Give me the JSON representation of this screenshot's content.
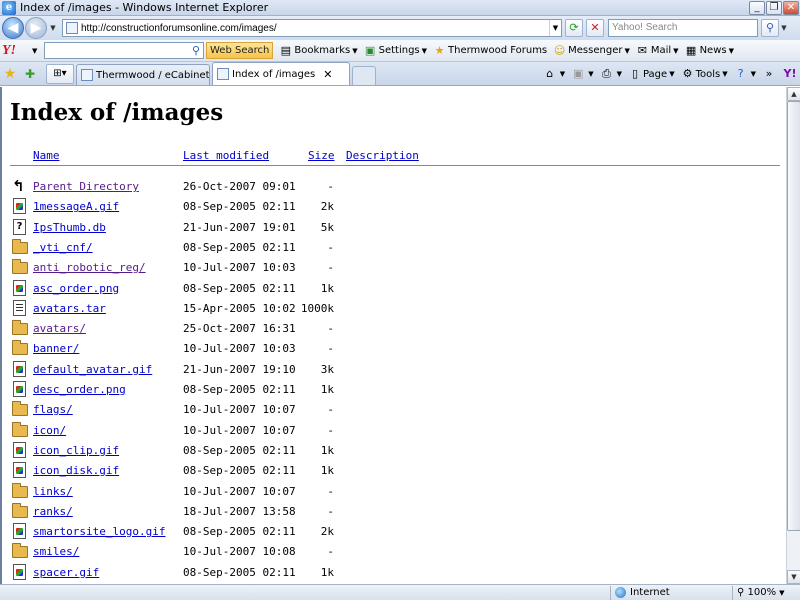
{
  "window": {
    "title": "Index of /images - Windows Internet Explorer",
    "minimize": "_",
    "restore": "❐",
    "close": "✕"
  },
  "address": {
    "url": "http://constructionforumsonline.com/images/",
    "search_placeholder": "Yahoo! Search"
  },
  "yahoo_toolbar": {
    "logo": "Y!",
    "web_search": "Web Search",
    "bookmarks": "Bookmarks",
    "settings": "Settings",
    "thermwood_forums": "Thermwood Forums",
    "messenger": "Messenger",
    "mail": "Mail",
    "news": "News"
  },
  "tabs": [
    {
      "label": "Thermwood / eCabinet Syst..."
    },
    {
      "label": "Index of /images"
    }
  ],
  "command_bar": {
    "page": "Page",
    "tools": "Tools"
  },
  "page": {
    "title": "Index of /images",
    "headers": {
      "name": "Name",
      "modified": "Last modified",
      "size": "Size",
      "description": "Description"
    },
    "entries": [
      {
        "icon": "back-arrow-icon",
        "name": "Parent Directory",
        "date": "26-Oct-2007 09:01",
        "size": "-",
        "visited": true
      },
      {
        "icon": "image-file-icon",
        "name": "1messageA.gif",
        "date": "08-Sep-2005 02:11",
        "size": "2k",
        "visited": false
      },
      {
        "icon": "unknown-file-icon",
        "name": "IpsThumb.db",
        "date": "21-Jun-2007 19:01",
        "size": "5k",
        "visited": false
      },
      {
        "icon": "folder-icon",
        "name": "_vti_cnf/",
        "date": "08-Sep-2005 02:11",
        "size": "-",
        "visited": false
      },
      {
        "icon": "folder-icon",
        "name": "anti_robotic_reg/",
        "date": "10-Jul-2007 10:03",
        "size": "-",
        "visited": true
      },
      {
        "icon": "image-file-icon",
        "name": "asc_order.png",
        "date": "08-Sep-2005 02:11",
        "size": "1k",
        "visited": false
      },
      {
        "icon": "archive-file-icon",
        "name": "avatars.tar",
        "date": "15-Apr-2005 10:02",
        "size": "1000k",
        "visited": false
      },
      {
        "icon": "folder-icon",
        "name": "avatars/",
        "date": "25-Oct-2007 16:31",
        "size": "-",
        "visited": true
      },
      {
        "icon": "folder-icon",
        "name": "banner/",
        "date": "10-Jul-2007 10:03",
        "size": "-",
        "visited": false
      },
      {
        "icon": "image-file-icon",
        "name": "default_avatar.gif",
        "date": "21-Jun-2007 19:10",
        "size": "3k",
        "visited": false
      },
      {
        "icon": "image-file-icon",
        "name": "desc_order.png",
        "date": "08-Sep-2005 02:11",
        "size": "1k",
        "visited": false
      },
      {
        "icon": "folder-icon",
        "name": "flags/",
        "date": "10-Jul-2007 10:07",
        "size": "-",
        "visited": false
      },
      {
        "icon": "folder-icon",
        "name": "icon/",
        "date": "10-Jul-2007 10:07",
        "size": "-",
        "visited": false
      },
      {
        "icon": "image-file-icon",
        "name": "icon_clip.gif",
        "date": "08-Sep-2005 02:11",
        "size": "1k",
        "visited": false
      },
      {
        "icon": "image-file-icon",
        "name": "icon_disk.gif",
        "date": "08-Sep-2005 02:11",
        "size": "1k",
        "visited": false
      },
      {
        "icon": "folder-icon",
        "name": "links/",
        "date": "10-Jul-2007 10:07",
        "size": "-",
        "visited": false
      },
      {
        "icon": "folder-icon",
        "name": "ranks/",
        "date": "18-Jul-2007 13:58",
        "size": "-",
        "visited": false
      },
      {
        "icon": "image-file-icon",
        "name": "smartorsite_logo.gif",
        "date": "08-Sep-2005 02:11",
        "size": "2k",
        "visited": false
      },
      {
        "icon": "folder-icon",
        "name": "smiles/",
        "date": "10-Jul-2007 10:08",
        "size": "-",
        "visited": false
      },
      {
        "icon": "image-file-icon",
        "name": "spacer.gif",
        "date": "08-Sep-2005 02:11",
        "size": "1k",
        "visited": false
      }
    ]
  },
  "status": {
    "text": "",
    "zone": "Internet",
    "zoom": "100%"
  },
  "colors": {
    "link": "#0000cc",
    "visited_link": "#551a8b",
    "chrome": "#cfdcee"
  }
}
